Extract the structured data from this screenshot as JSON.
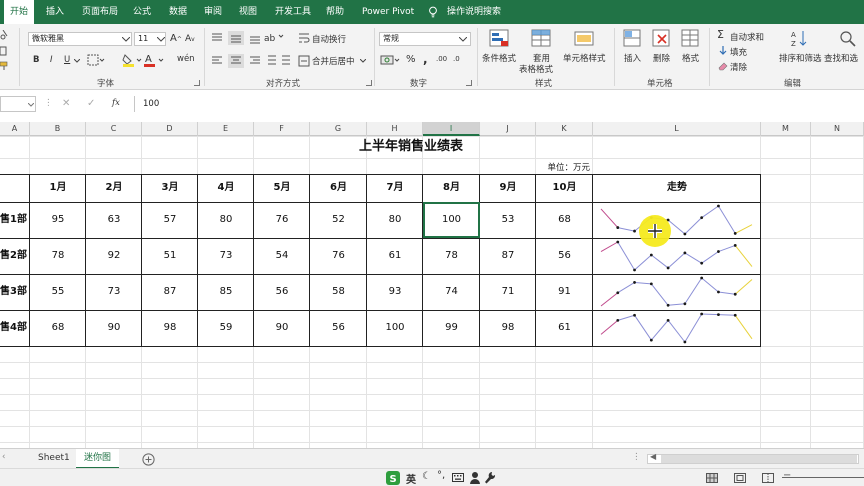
{
  "menu": {
    "tabs": [
      "开始",
      "插入",
      "页面布局",
      "公式",
      "数据",
      "审阅",
      "视图",
      "开发工具",
      "帮助",
      "Power Pivot"
    ],
    "tell_me": "操作说明搜索"
  },
  "ribbon": {
    "font_name": "微软雅黑",
    "font_size": "11",
    "bold": "B",
    "italic": "I",
    "underline": "U",
    "wrap_text": "自动换行",
    "merge_center": "合并后居中",
    "number_format": "常规",
    "percent": "%",
    "comma": ",",
    "conditional_format": "条件格式",
    "format_as_table_1": "套用",
    "format_as_table_2": "表格格式",
    "cell_styles": "单元格样式",
    "insert": "插入",
    "delete": "删除",
    "format": "格式",
    "autosum": "自动求和",
    "fill": "填充",
    "clear": "清除",
    "sort_filter": "排序和筛选",
    "find_select": "查找和选",
    "groups": {
      "font": "字体",
      "alignment": "对齐方式",
      "number": "数字",
      "styles": "样式",
      "cells": "单元格",
      "editing": "编辑"
    }
  },
  "formula_bar": {
    "fx": "fx",
    "value": "100"
  },
  "columns": [
    "A",
    "B",
    "C",
    "D",
    "E",
    "F",
    "G",
    "H",
    "I",
    "J",
    "K",
    "L",
    "M",
    "N"
  ],
  "sheet": {
    "title": "上半年销售业绩表",
    "unit": "单位：万元",
    "months": [
      "1月",
      "2月",
      "3月",
      "4月",
      "5月",
      "6月",
      "7月",
      "8月",
      "9月",
      "10月"
    ],
    "trend_header": "走势",
    "rows": [
      {
        "dept": "售1部",
        "values": [
          95,
          63,
          57,
          80,
          76,
          52,
          80,
          100,
          53,
          68
        ]
      },
      {
        "dept": "售2部",
        "values": [
          78,
          92,
          51,
          73,
          54,
          76,
          61,
          78,
          87,
          56
        ]
      },
      {
        "dept": "售3部",
        "values": [
          55,
          73,
          87,
          85,
          56,
          58,
          93,
          74,
          71,
          91
        ]
      },
      {
        "dept": "售4部",
        "values": [
          68,
          90,
          98,
          59,
          90,
          56,
          100,
          99,
          98,
          61
        ]
      }
    ]
  },
  "sparkline_colors": {
    "line": "#8b8fd6",
    "marker": "#1a1a1a",
    "high": "#e8d23a",
    "first": "#c04a8c"
  },
  "sheet_tabs": [
    "Sheet1",
    "迷你图"
  ],
  "accent": "#217346",
  "status": {
    "ime": "英"
  }
}
